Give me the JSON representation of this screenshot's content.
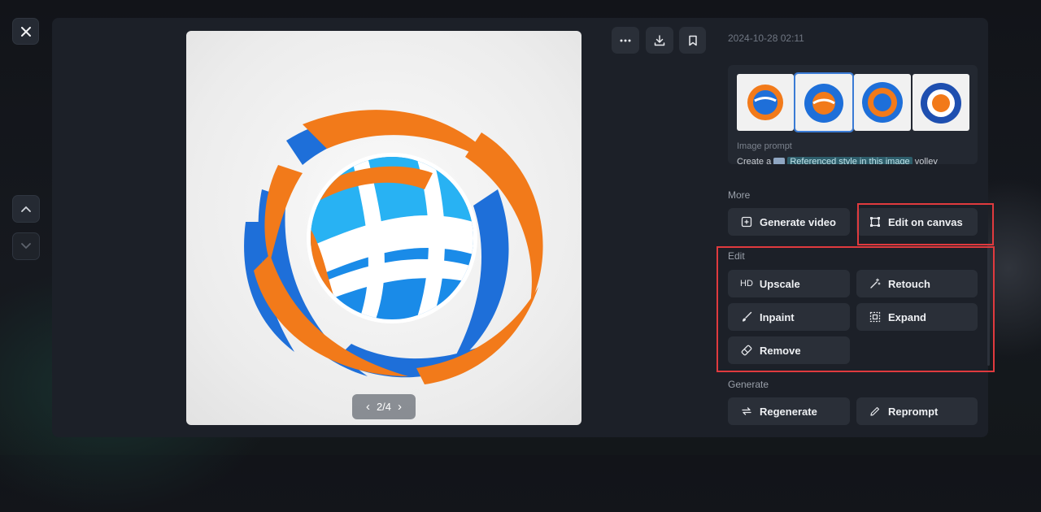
{
  "viewer": {
    "close_icon": "close-icon",
    "nav_up_icon": "chevron-up-icon",
    "nav_down_icon": "chevron-down-icon",
    "pager": {
      "current": "2/4"
    },
    "toolbar": {
      "more_icon": "more-horizontal-icon",
      "download_icon": "download-icon",
      "bookmark_icon": "bookmark-icon"
    }
  },
  "details": {
    "timestamp": "2024-10-28 02:11",
    "prompt_label": "Image prompt",
    "prompt_prefix": "Create a",
    "prompt_chip": "Referenced style in this image",
    "prompt_suffix": "volley",
    "thumbnails_count": 4
  },
  "sections": {
    "more": {
      "label": "More",
      "generate_video": "Generate video",
      "edit_on_canvas": "Edit on canvas"
    },
    "edit": {
      "label": "Edit",
      "upscale_badge": "HD",
      "upscale": "Upscale",
      "retouch": "Retouch",
      "inpaint": "Inpaint",
      "expand": "Expand",
      "remove": "Remove"
    },
    "generate": {
      "label": "Generate",
      "regenerate": "Regenerate",
      "reprompt": "Reprompt"
    }
  },
  "colors": {
    "highlight": "#e03a3e",
    "logo_blue": "#1e6fd9",
    "logo_orange": "#f27a1a"
  }
}
